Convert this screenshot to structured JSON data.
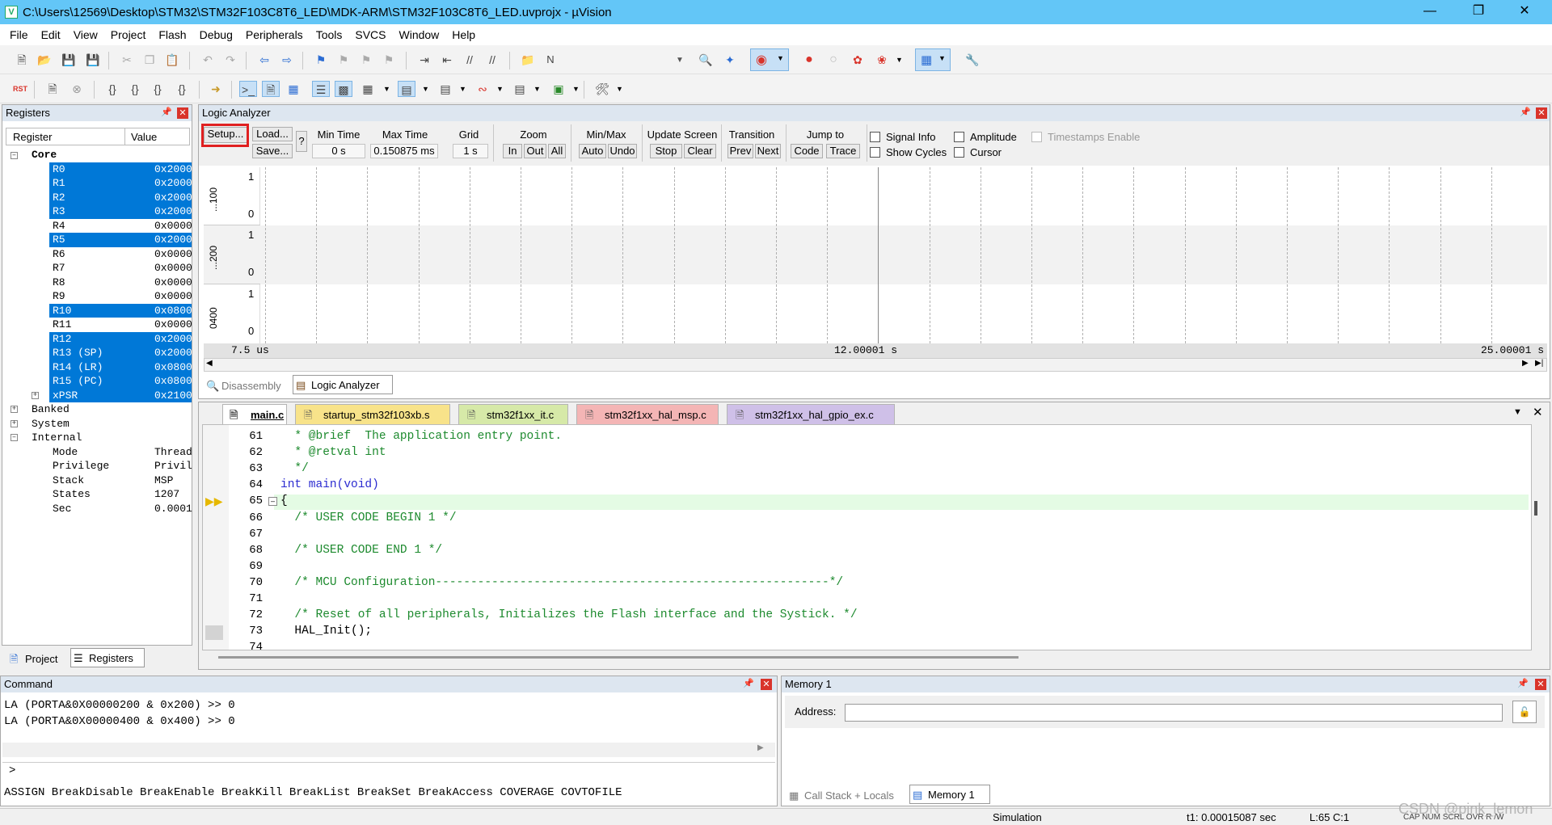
{
  "window": {
    "title": "C:\\Users\\12569\\Desktop\\STM32\\STM32F103C8T6_LED\\MDK-ARM\\STM32F103C8T6_LED.uvprojx - µVision"
  },
  "menu": [
    "File",
    "Edit",
    "View",
    "Project",
    "Flash",
    "Debug",
    "Peripherals",
    "Tools",
    "SVCS",
    "Window",
    "Help"
  ],
  "toolbar": {
    "find_text": "N",
    "reset_label": "RST"
  },
  "registers": {
    "title": "Registers",
    "col_register": "Register",
    "col_value": "Value",
    "core_label": "Core",
    "rows": [
      {
        "name": "R0",
        "value": "0x2000",
        "selected": true
      },
      {
        "name": "R1",
        "value": "0x2000",
        "selected": true
      },
      {
        "name": "R2",
        "value": "0x2000",
        "selected": true
      },
      {
        "name": "R3",
        "value": "0x2000",
        "selected": true
      },
      {
        "name": "R4",
        "value": "0x0000",
        "selected": false
      },
      {
        "name": "R5",
        "value": "0x2000",
        "selected": true
      },
      {
        "name": "R6",
        "value": "0x0000",
        "selected": false
      },
      {
        "name": "R7",
        "value": "0x0000",
        "selected": false
      },
      {
        "name": "R8",
        "value": "0x0000",
        "selected": false
      },
      {
        "name": "R9",
        "value": "0x0000",
        "selected": false
      },
      {
        "name": "R10",
        "value": "0x0800",
        "selected": true
      },
      {
        "name": "R11",
        "value": "0x0000",
        "selected": false
      },
      {
        "name": "R12",
        "value": "0x2000",
        "selected": true
      },
      {
        "name": "R13 (SP)",
        "value": "0x2000",
        "selected": true
      },
      {
        "name": "R14 (LR)",
        "value": "0x0800",
        "selected": true
      },
      {
        "name": "R15 (PC)",
        "value": "0x0800",
        "selected": true
      },
      {
        "name": "xPSR",
        "value": "0x2100",
        "selected": true
      }
    ],
    "groups": [
      "Banked",
      "System",
      "Internal"
    ],
    "internal": [
      {
        "name": "Mode",
        "value": "Thread"
      },
      {
        "name": "Privilege",
        "value": "Privil"
      },
      {
        "name": "Stack",
        "value": "MSP"
      },
      {
        "name": "States",
        "value": "1207"
      },
      {
        "name": "Sec",
        "value": "0.0001"
      }
    ],
    "tab_project": "Project",
    "tab_registers": "Registers"
  },
  "logic": {
    "title": "Logic Analyzer",
    "setup": "Setup...",
    "load": "Load...",
    "save": "Save...",
    "help": "?",
    "min_time_label": "Min Time",
    "min_time": "0 s",
    "max_time_label": "Max Time",
    "max_time": "0.150875 ms",
    "grid_label": "Grid",
    "grid": "1 s",
    "zoom_label": "Zoom",
    "zoom_in": "In",
    "zoom_out": "Out",
    "zoom_all": "All",
    "minmax_label": "Min/Max",
    "auto": "Auto",
    "undo": "Undo",
    "update_label": "Update Screen",
    "stop": "Stop",
    "clear": "Clear",
    "transition_label": "Transition",
    "prev": "Prev",
    "next": "Next",
    "jump_label": "Jump to",
    "code": "Code",
    "trace": "Trace",
    "signal_info": "Signal Info",
    "show_cycles": "Show Cycles",
    "amplitude": "Amplitude",
    "cursor": "Cursor",
    "timestamps": "Timestamps Enable",
    "signals": [
      {
        "label": "...100",
        "high": "1",
        "low": "0"
      },
      {
        "label": "...200",
        "high": "1",
        "low": "0"
      },
      {
        "label": "0400",
        "high": "1",
        "low": "0"
      }
    ],
    "time_left": "7.5 us",
    "time_mid": "12.00001 s",
    "time_right": "25.00001 s",
    "tab_disassembly": "Disassembly",
    "tab_logic": "Logic Analyzer"
  },
  "editor": {
    "tabs": [
      "main.c",
      "startup_stm32f103xb.s",
      "stm32f1xx_it.c",
      "stm32f1xx_hal_msp.c",
      "stm32f1xx_hal_gpio_ex.c"
    ],
    "lines": [
      {
        "n": "61",
        "text": "  * @brief  The application entry point."
      },
      {
        "n": "62",
        "text": "  * @retval int"
      },
      {
        "n": "63",
        "text": "  */"
      },
      {
        "n": "64",
        "text": "int main(void)"
      },
      {
        "n": "65",
        "text": "{"
      },
      {
        "n": "66",
        "text": "  /* USER CODE BEGIN 1 */"
      },
      {
        "n": "67",
        "text": ""
      },
      {
        "n": "68",
        "text": "  /* USER CODE END 1 */"
      },
      {
        "n": "69",
        "text": ""
      },
      {
        "n": "70",
        "text": "  /* MCU Configuration--------------------------------------------------------*/"
      },
      {
        "n": "71",
        "text": ""
      },
      {
        "n": "72",
        "text": "  /* Reset of all peripherals, Initializes the Flash interface and the Systick. */"
      },
      {
        "n": "73",
        "text": "  HAL_Init();"
      },
      {
        "n": "74",
        "text": ""
      }
    ]
  },
  "command": {
    "title": "Command",
    "lines": [
      "LA (PORTA&0X00000200 & 0x200) >> 0",
      "LA (PORTA&0X00000400 & 0x400) >> 0"
    ],
    "prompt": ">",
    "keywords": "ASSIGN BreakDisable BreakEnable BreakKill BreakList BreakSet BreakAccess COVERAGE COVTOFILE"
  },
  "memory": {
    "title": "Memory 1",
    "address_label": "Address:",
    "address_value": "",
    "tab_callstack": "Call Stack + Locals",
    "tab_memory": "Memory 1"
  },
  "status": {
    "mode": "Simulation",
    "t1": "t1: 0.00015087 sec",
    "pos": "L:65 C:1",
    "caps": "CAP  NUM  SCRL  OVR  R /W",
    "watermark": "CSDN @pink_lemon"
  }
}
